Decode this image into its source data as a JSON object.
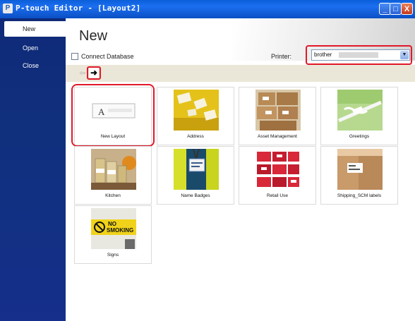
{
  "window": {
    "title": "P-touch Editor - [Layout2]",
    "buttons": {
      "minimize": "_",
      "maximize": "□",
      "close": "X"
    }
  },
  "sidebar": {
    "items": [
      {
        "label": "New",
        "active": true
      },
      {
        "label": "Open",
        "active": false
      },
      {
        "label": "Close",
        "active": false
      }
    ]
  },
  "main": {
    "title": "New",
    "connect_database": {
      "label": "Connect Database",
      "checked": false
    },
    "printer": {
      "label": "Printer:",
      "value": "brother",
      "dropdown_icon": "chevron-down-icon"
    },
    "nav": {
      "back_icon": "arrow-left-icon",
      "forward_icon": "arrow-right-icon",
      "back_glyph": "⇦",
      "forward_glyph": "➜"
    },
    "tiles": [
      {
        "label": "New Layout",
        "thumb": "new-layout"
      },
      {
        "label": "Address",
        "thumb": "address"
      },
      {
        "label": "Asset Management",
        "thumb": "asset"
      },
      {
        "label": "Greetings",
        "thumb": "greetings"
      },
      {
        "label": "Kitchen",
        "thumb": "kitchen"
      },
      {
        "label": "Name Badges",
        "thumb": "badges"
      },
      {
        "label": "Retail Use",
        "thumb": "retail"
      },
      {
        "label": "Shipping_SCM labels",
        "thumb": "shipping"
      },
      {
        "label": "Signs",
        "thumb": "signs"
      }
    ],
    "new_layout_glyph": "A",
    "sign_text": {
      "line1": "NO",
      "line2": "SMOKING"
    }
  },
  "colors": {
    "highlight": "#e0192a",
    "sidebar": "#10307e",
    "titlebar": "#0b5fd9"
  }
}
